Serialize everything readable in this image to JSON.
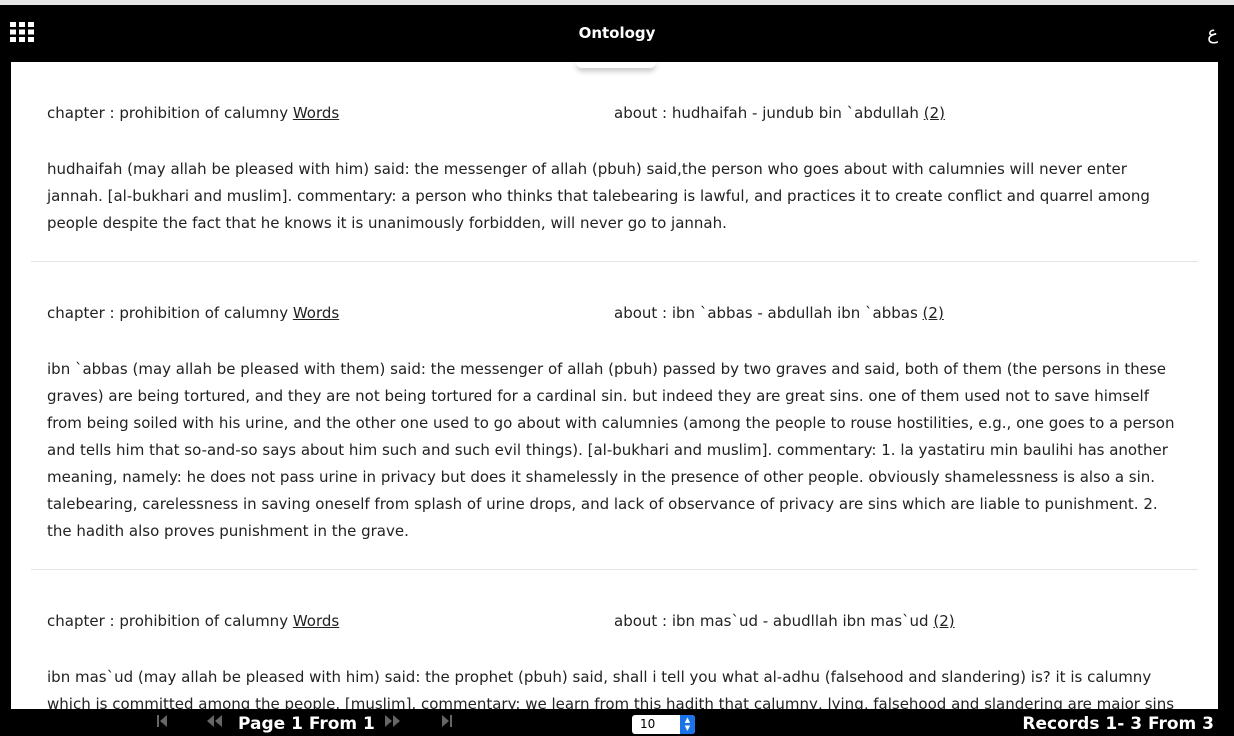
{
  "header": {
    "title": "Ontology",
    "lang_label": "ع"
  },
  "records": [
    {
      "chapter_prefix": "chapter : prohibition of calumny ",
      "chapter_link": "Words",
      "about_prefix": "about : hudhaifah - jundub bin `abdullah ",
      "about_link": "(2)",
      "text": "hudhaifah (may allah be pleased with him) said: the messenger of allah (pbuh) said,the person who goes about with calumnies will never enter jannah. [al-bukhari and muslim]. commentary: a person who thinks that talebearing is lawful, and practices it to create conflict and quarrel among people despite the fact that he knows it is unanimously forbidden, will never go to jannah."
    },
    {
      "chapter_prefix": "chapter : prohibition of calumny ",
      "chapter_link": "Words",
      "about_prefix": "about : ibn `abbas - abdullah ibn `abbas ",
      "about_link": "(2)",
      "text": "ibn `abbas (may allah be pleased with them) said: the messenger of allah (pbuh) passed by two graves and said, both of them (the persons in these graves) are being tortured, and they are not being tortured for a cardinal sin. but indeed they are great sins. one of them used not to save himself from being soiled with his urine, and the other one used to go about with calumnies (among the people to rouse hostilities, e.g., one goes to a person and tells him that so-and-so says about him such and such evil things). [al-bukhari and muslim]. commentary: 1. la yastatiru min baulihi has another meaning, namely: he does not pass urine in privacy but does it shamelessly in the presence of other people. obviously shamelessness is also a sin. talebearing, carelessness in saving oneself from splash of urine drops, and lack of observance of privacy are sins which are liable to punishment. 2. the hadith also proves punishment in the grave."
    },
    {
      "chapter_prefix": "chapter : prohibition of calumny ",
      "chapter_link": "Words",
      "about_prefix": "about : ibn mas`ud - abudllah ibn mas`ud ",
      "about_link": "(2)",
      "text": "ibn mas`ud (may allah be pleased with him) said: the prophet (pbuh) said, shall i tell you what al-adhu (falsehood and slandering) is? it is calumny which is committed among the people. [muslim]. commentary: we learn from this hadith that calumny, lying, falsehood and slandering are major sins because they cause conflict and dissension in society. a muslim must keep himself free from such evils."
    }
  ],
  "footer": {
    "page_label": "Page 1 From 1",
    "page_size": "10",
    "records_label": "Records 1- 3 From 3",
    "icons": [
      "first-page-icon",
      "previous-page-icon",
      "next-page-icon",
      "last-page-icon"
    ]
  }
}
